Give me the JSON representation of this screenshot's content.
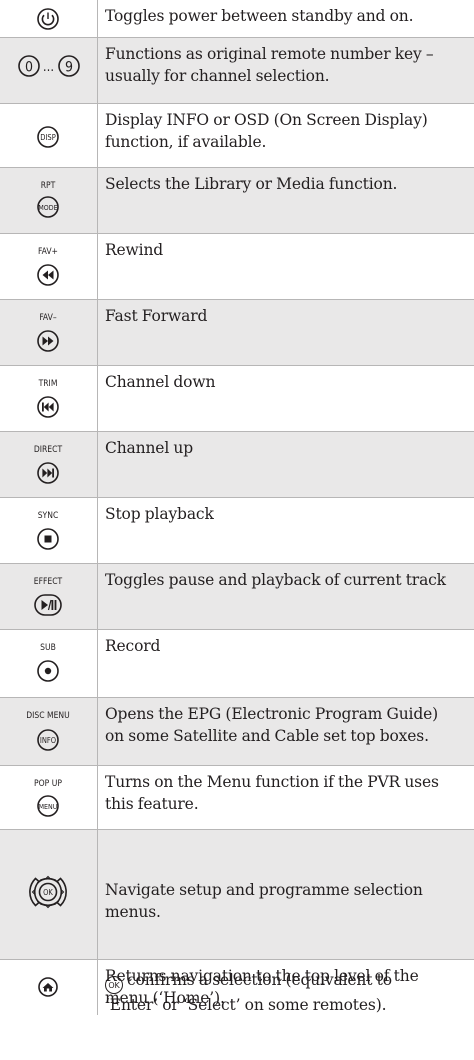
{
  "rows": [
    {
      "icon": "power-icon",
      "text": "Toggles power between standby and on."
    },
    {
      "icon": "number-keys-icon",
      "key_start": "0",
      "key_ellipsis": "...",
      "key_end": "9",
      "text": "Functions as original remote number key –\nusually for channel selection."
    },
    {
      "icon": "disp-button-icon",
      "button_label": "DISP",
      "text": "Display INFO or OSD (On Screen Display)\nfunction, if available."
    },
    {
      "icon": "mode-button-icon",
      "top_label": "RPT",
      "button_label": "MODE",
      "text": "Selects the Library or Media function."
    },
    {
      "icon": "rewind-icon",
      "top_label": "FAV+",
      "text": "Rewind"
    },
    {
      "icon": "fast-forward-icon",
      "top_label": "FAV–",
      "text": "Fast Forward"
    },
    {
      "icon": "skip-back-icon",
      "top_label": "TRIM",
      "text": "Channel down"
    },
    {
      "icon": "skip-forward-icon",
      "top_label": "DIRECT",
      "text": "Channel up"
    },
    {
      "icon": "stop-icon",
      "top_label": "SYNC",
      "text": "Stop playback"
    },
    {
      "icon": "play-pause-icon",
      "top_label": "EFFECT",
      "text": "Toggles pause and playback of current track"
    },
    {
      "icon": "record-icon",
      "top_label": "SUB",
      "text": "Record"
    },
    {
      "icon": "info-button-icon",
      "top_label": "DISC MENU",
      "button_label": "INFO",
      "text": "Opens the EPG (Electronic Program Guide)\non some Satellite and Cable set top boxes."
    },
    {
      "icon": "menu-button-icon",
      "top_label": "POP UP",
      "button_label": "MENU",
      "text": "Turns on the Menu function if the PVR uses\nthis feature."
    },
    {
      "icon": "navigation-pad-icon",
      "button_label": "OK",
      "text": "Navigate setup and programme selection\nmenus.",
      "ok_label": "OK",
      "text2": "confirms a selection (equivalent to\n‘Enter’ or ‘Select’ on some remotes)."
    },
    {
      "icon": "home-button-icon",
      "text": "Returns navigation to the top level of the\nmenu (‘Home’)."
    }
  ]
}
